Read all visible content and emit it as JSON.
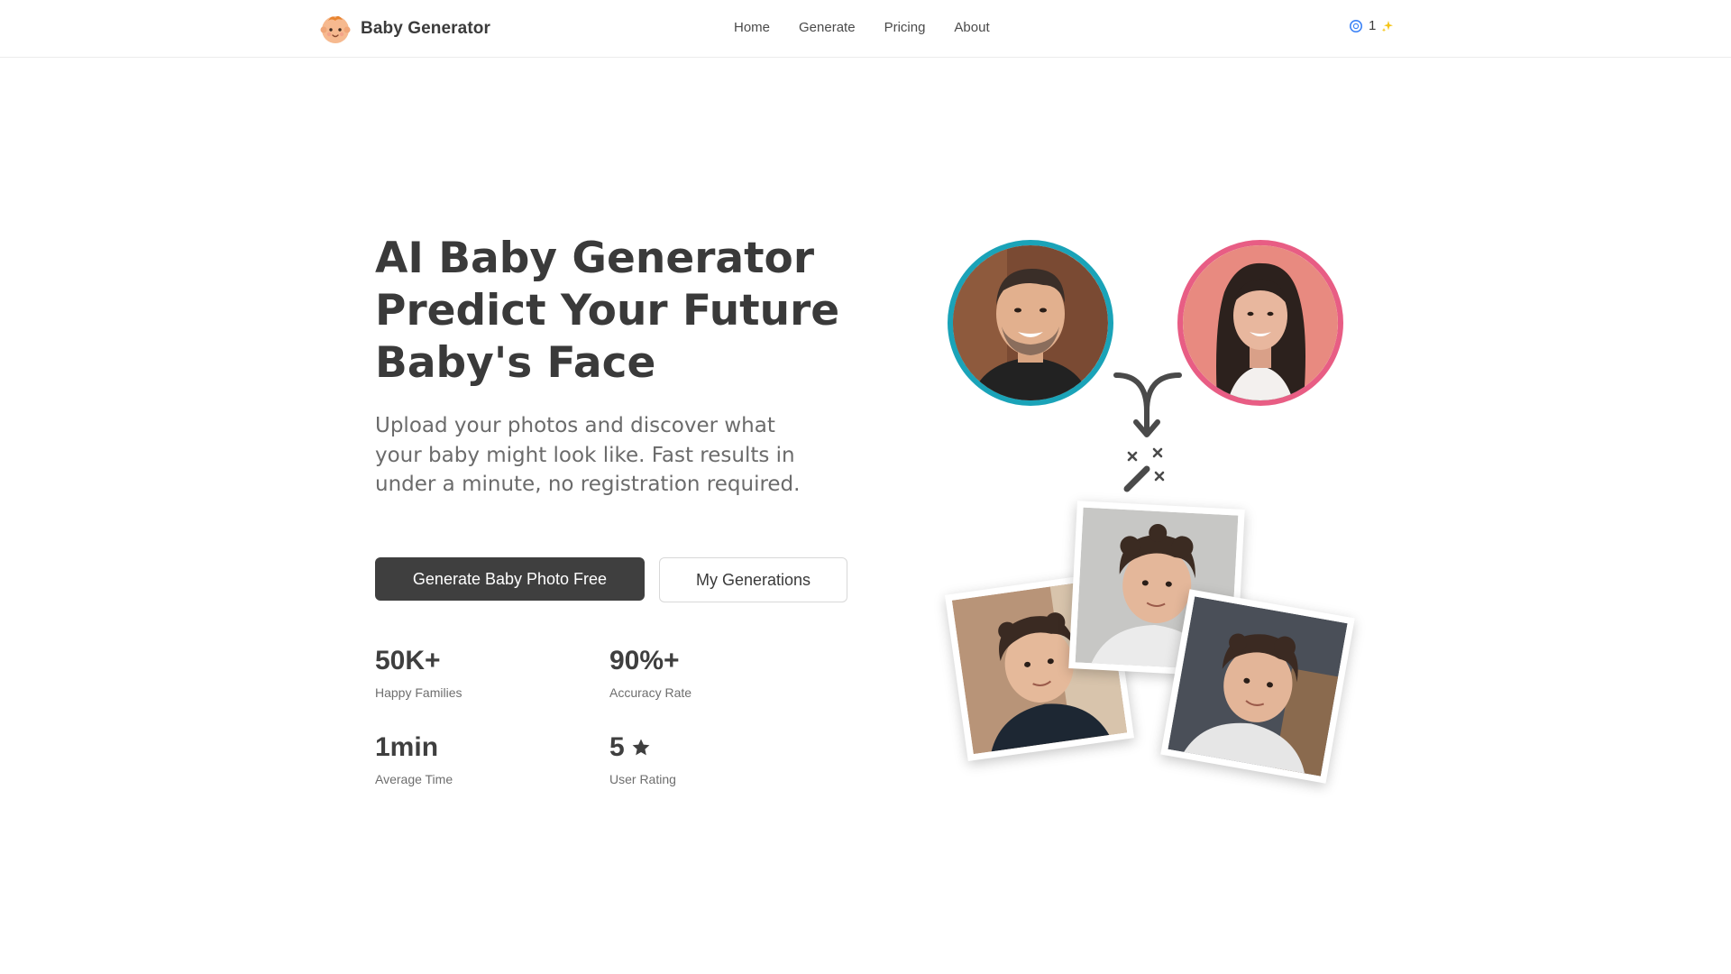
{
  "header": {
    "brand_name": "Baby Generator",
    "nav": [
      "Home",
      "Generate",
      "Pricing",
      "About"
    ],
    "credits_count": "1"
  },
  "hero": {
    "title_lines": [
      "AI Baby Generator",
      "Predict Your Future",
      "Baby's Face"
    ],
    "description": "Upload your photos and discover what your baby might look like. Fast results in under a minute, no registration required.",
    "primary_button": "Generate Baby Photo Free",
    "secondary_button": "My Generations"
  },
  "stats": [
    {
      "value": "50K+",
      "label": "Happy Families"
    },
    {
      "value": "90%+",
      "label": "Accuracy Rate"
    },
    {
      "value": "1min",
      "label": "Average Time"
    },
    {
      "value": "5",
      "label": "User Rating",
      "icon": "star-icon"
    }
  ],
  "colors": {
    "primary_button": "#3f3f3f",
    "father_ring": "#1aa3b8",
    "mother_ring": "#e85d84",
    "credits_icon": "#3b82f6",
    "sparkle": "#f5c518"
  },
  "illustration": {
    "father_photo": "father-portrait",
    "mother_photo": "mother-portrait",
    "merge_icon": "merge-arrow-icon",
    "magic_icon": "magic-wand-icon",
    "baby_photos": [
      "baby-photo-left",
      "baby-photo-center",
      "baby-photo-right"
    ]
  }
}
